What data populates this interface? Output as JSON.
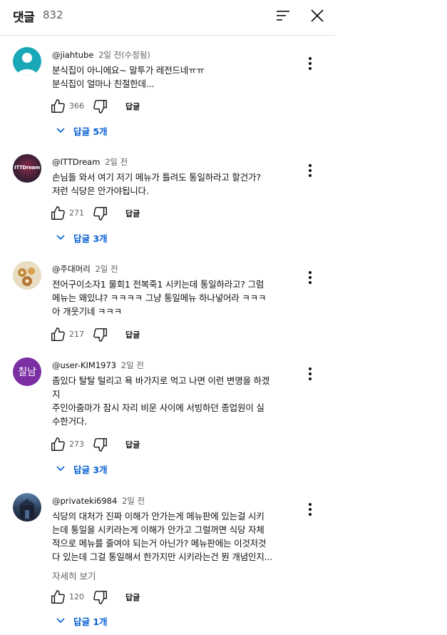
{
  "header": {
    "title": "댓글",
    "count": "832",
    "sort_icon": "sort-icon",
    "close_icon": "close-icon"
  },
  "comments": [
    {
      "author": "@jiahtube",
      "time": "2일 전(수정됨)",
      "text": "분식집이 아니에요~ 말투가 레전드네ㅠㅠ\n분식집이 얼마나 친절한데...",
      "likes": "366",
      "reply_label": "답글",
      "replies": "답글 5개"
    },
    {
      "author": "@ITTDream",
      "time": "2일 전",
      "avatar_text": "ITTDream",
      "text": "손님들 와서 여기 저기 메뉴가 틀려도 통일하라고 할건가?\n저런 식당은 안가야됩니다.",
      "likes": "271",
      "reply_label": "답글",
      "replies": "답글 3개"
    },
    {
      "author": "@주대머리",
      "time": "2일 전",
      "text": "전어구이소자1 물회1 전복죽1 시키는데 통일하라고? 그럼\n메뉴는 왜있냐? ㅋㅋㅋㅋ 그냥 통일메뉴 하나넣어라 ㅋㅋㅋ\n아 개웃기네 ㅋㅋㅋ",
      "likes": "217",
      "reply_label": "답글"
    },
    {
      "author": "@user-KIM1973",
      "time": "2일 전",
      "avatar_text": "칠남",
      "text": "좀있다 탈탈 털리고 욕 바가지로 먹고 나면 이런 변명을 하겠\n지\n주인아줌마가 잠시 자리 비운 사이에 서빙하던 종업원이 실\n수한거다.",
      "likes": "273",
      "reply_label": "답글",
      "replies": "답글 3개"
    },
    {
      "author": "@privateki6984",
      "time": "2일 전",
      "text": "식당의 대처가 진짜 이해가 안가는게 메뉴판에 있는걸 시키\n는데 통일을 시키라는게 이해가 안가고 그럴꺼면 식당 자체\n적으로 메뉴를 줄여야 되는거 아닌가? 메뉴판에는 이것저것\n다 있는데 그걸 통일해서 한가지만 시키라는건 뭔 개념인지...",
      "read_more": "자세히 보기",
      "likes": "120",
      "reply_label": "답글",
      "replies": "답글 1개"
    }
  ],
  "colors": {
    "link_blue": "#065fd4",
    "avatar_teal": "#18a8b8",
    "avatar_purple": "#7b2fa3",
    "secondary_text": "#606060"
  },
  "icons": [
    "like-icon",
    "dislike-icon",
    "more-vert-icon",
    "chevron-down-icon"
  ]
}
